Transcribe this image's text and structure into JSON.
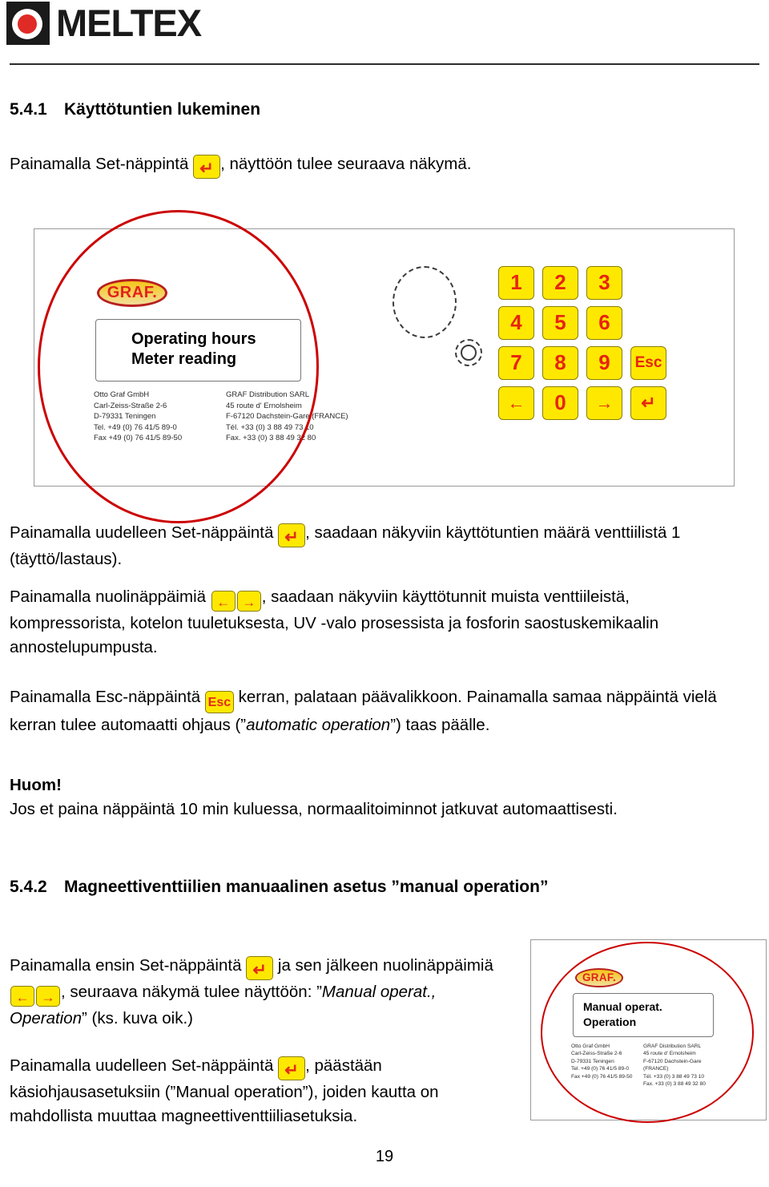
{
  "header": {
    "brand": "MELTEX",
    "logo_icon": "meltex-logo-icon"
  },
  "sections": {
    "s541": {
      "number": "5.4.1",
      "title": "Käyttötuntien lukeminen"
    },
    "s542": {
      "number": "5.4.2",
      "title": "Magneettiventtiilien manuaalinen asetus ”manual operation”"
    }
  },
  "paragraphs": {
    "intro": {
      "before": "Painamalla Set-näppintä",
      "after": ", näyttöön tulee seuraava näkymä."
    },
    "again": {
      "before": "Painamalla uudelleen Set-näppäintä",
      "after": ", saadaan näkyviin käyttötuntien määrä venttiilistä 1 (täyttö/lastaus)."
    },
    "arrows": {
      "before": "Painamalla nuolinäppäimiä",
      "after": ", saadaan näkyviin käyttötunnit muista venttiileistä, kompressorista, kotelon tuuletuksesta, UV -valo prosessista ja fosforin saostuskemikaalin annostelupumpusta."
    },
    "esc": {
      "before": "Painamalla Esc-näppäintä",
      "mid": "kerran, palataan päävalikkoon. Painamalla samaa näppäintä vielä kerran tulee automaatti ohjaus (”",
      "italic": "automatic operation",
      "after": "”) taas päälle."
    },
    "note": {
      "title": "Huom!",
      "text": "Jos et paina näppäintä 10 min kuluessa, normaalitoiminnot jatkuvat automaattisesti."
    },
    "manual1": {
      "before": "Painamalla ensin Set-näppäintä",
      "mid": "ja sen jälkeen nuolinäppäimiä",
      "after": ", seuraava näkymä tulee näyttöön:",
      "quote_open": "”",
      "italic": "Manual operat., Operation",
      "quote_close": "”",
      "tail": " (ks. kuva oik.)"
    },
    "manual2": {
      "before": "Painamalla uudelleen Set-näppäintä",
      "after": ", päästään käsiohjausasetuksiin (”Manual operation”), joiden kautta on mahdollista muuttaa magneettiventtiiliasetuksia."
    }
  },
  "keys": {
    "set_glyph": "↵",
    "left_glyph": "←",
    "right_glyph": "→",
    "esc_label": "Esc"
  },
  "device_top": {
    "brand": "GRAF.",
    "display_line1": "Operating hours",
    "display_line2": "Meter reading",
    "address_left": [
      "Otto Graf GmbH",
      "Carl-Zeiss-Straße 2-6",
      "D-79331 Teningen",
      "Tel. +49 (0) 76 41/5 89-0",
      "Fax +49 (0) 76 41/5 89-50"
    ],
    "address_right": [
      "GRAF Distribution SARL",
      "45 route d' Ernolsheim",
      "F-67120 Dachstein-Gare (FRANCE)",
      "Tél. +33 (0) 3 88 49 73 10",
      "Fax. +33 (0) 3 88 49 32 80"
    ],
    "keypad_rows": [
      [
        "1",
        "2",
        "3"
      ],
      [
        "4",
        "5",
        "6"
      ],
      [
        "7",
        "8",
        "9",
        "Esc"
      ],
      [
        "←",
        "0",
        "→",
        "↵"
      ]
    ]
  },
  "device_bottom": {
    "brand": "GRAF.",
    "display_line1": "Manual operat.",
    "display_line2": "Operation",
    "address_left": [
      "Otto Graf GmbH",
      "Carl-Zeiss-Straße 2-6",
      "D-79331 Teningen",
      "Tel. +49 (0) 76 41/5 89-0",
      "Fax +49 (0) 76 41/5 89-50"
    ],
    "address_right": [
      "GRAF Distribution SARL",
      "45 route d' Ernolsheim",
      "F-67120 Dachstein-Gare (FRANCE)",
      "Tél. +33 (0) 3 88 49 73 10",
      "Fax. +33 (0) 3 88 49 32 80"
    ]
  },
  "footer": {
    "page_number": "19"
  },
  "colors": {
    "key_yellow": "#ffe800",
    "key_border": "#8a7d00",
    "key_red": "#e8240f",
    "annotation_red": "#cc0000",
    "brand_black": "#1a1a1a",
    "logo_red": "#e02a26"
  }
}
